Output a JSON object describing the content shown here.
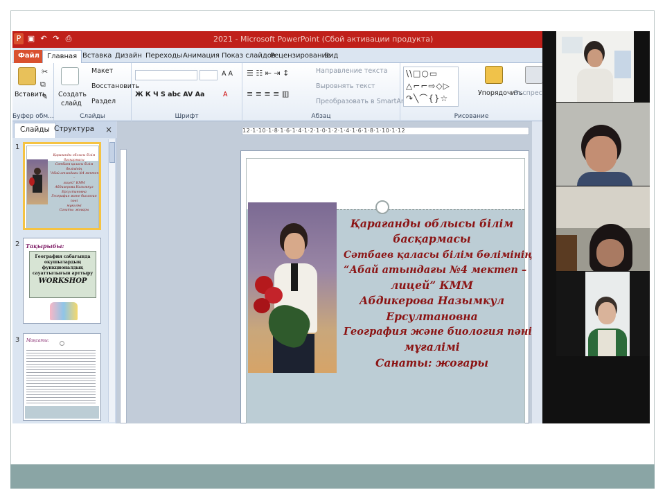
{
  "window": {
    "title": "2021 - Microsoft PowerPoint (Сбой активации продукта)"
  },
  "ribbon_tabs": [
    "Файл",
    "Главная",
    "Вставка",
    "Дизайн",
    "Переходы",
    "Анимация",
    "Показ слайдов",
    "Рецензирование",
    "Вид"
  ],
  "ribbon": {
    "clipboard": {
      "paste": "Вставить",
      "group": "Буфер обм..."
    },
    "slides": {
      "create": "Создать",
      "create2": "слайд",
      "layout": "Макет",
      "reset": "Восстановить",
      "section": "Раздел",
      "group": "Слайды"
    },
    "font": {
      "group": "Шрифт",
      "styles": "Ж К Ч S abc AV Aa",
      "grow": "A A",
      "color": "A"
    },
    "paragraph": {
      "group": "Абзац",
      "direction": "Направление текста",
      "align": "Выровнять текст",
      "smartart": "Преобразовать в SmartArt"
    },
    "drawing": {
      "arrange": "Упорядочить",
      "styles": "Экспресс-стили",
      "group": "Рисование",
      "shapes": "\\\\□○▭ △⌐⌐⇨◇▷ ↷╲⌒{}☆"
    }
  },
  "panel": {
    "tab_slides": "Слайды",
    "tab_outline": "Структура",
    "close": "×",
    "thumbs": [
      {
        "num": "1"
      },
      {
        "num": "2",
        "heading": "Тақырыбы:",
        "box": "География сабағында оқушылардың функционалдық сауаттылығын арттыру",
        "workshop": "WORKSHOP"
      },
      {
        "num": "3",
        "heading": "Мақсаты:"
      }
    ]
  },
  "ruler": "12·1·10·1·8·1·6·1·4·1·2·1·0·1·2·1·4·1·6·1·8·1·10·1·12",
  "slide": {
    "lines": [
      "Қарағанды облысы білім",
      "басқармасы",
      "Сәтбаев қаласы білім бөлімінің",
      "“Абай атындағы №4 мектеп –",
      "лицей” КММ",
      "Абдикерова Назымкул",
      "Ерсултановна",
      "География және биология пәні",
      "мұғалімі",
      "Санаты: жоғары"
    ]
  },
  "thumb1_lines": [
    "Қарағанды облысы білім",
    "басқармасы",
    "Сәтбаев қаласы білім бөлімінің",
    "“Абай атындағы №4 мектеп –",
    "лицей” КММ",
    "Абдикерова Назымкул",
    "Ерсултановна",
    "География және биология пәні",
    "мұғалімі",
    "Санаты: жоғары"
  ],
  "colors": {
    "titlebar": "#c0201a",
    "slide_text": "#8b1414",
    "band": "#8aa5a5"
  }
}
